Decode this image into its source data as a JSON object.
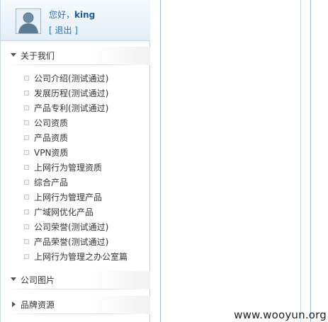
{
  "user": {
    "greeting": "您好，",
    "username": "king",
    "logout_label": "[ 退出 ]"
  },
  "sections": {
    "about": {
      "label": "关于我们",
      "expanded": true
    },
    "photos": {
      "label": "公司图片",
      "expanded": true
    },
    "brand": {
      "label": "品牌资源",
      "expanded": false
    }
  },
  "menu": {
    "items": [
      {
        "label": "公司介绍(测试通过)"
      },
      {
        "label": "发展历程(测试通过)"
      },
      {
        "label": "产品专利(测试通过)"
      },
      {
        "label": "公司资质"
      },
      {
        "label": "产品资质"
      },
      {
        "label": "VPN资质"
      },
      {
        "label": "上网行为管理资质"
      },
      {
        "label": "综合产品"
      },
      {
        "label": "上网行为管理产品"
      },
      {
        "label": "广域网优化产品"
      },
      {
        "label": "公司荣誉(测试通过)"
      },
      {
        "label": "产品荣誉(测试通过)"
      },
      {
        "label": "上网行为管理之办公室篇"
      }
    ]
  },
  "watermark": "www.wooyun.org",
  "colors": {
    "link": "#2d6fb4",
    "border": "#b9d0e3",
    "text": "#333333"
  }
}
